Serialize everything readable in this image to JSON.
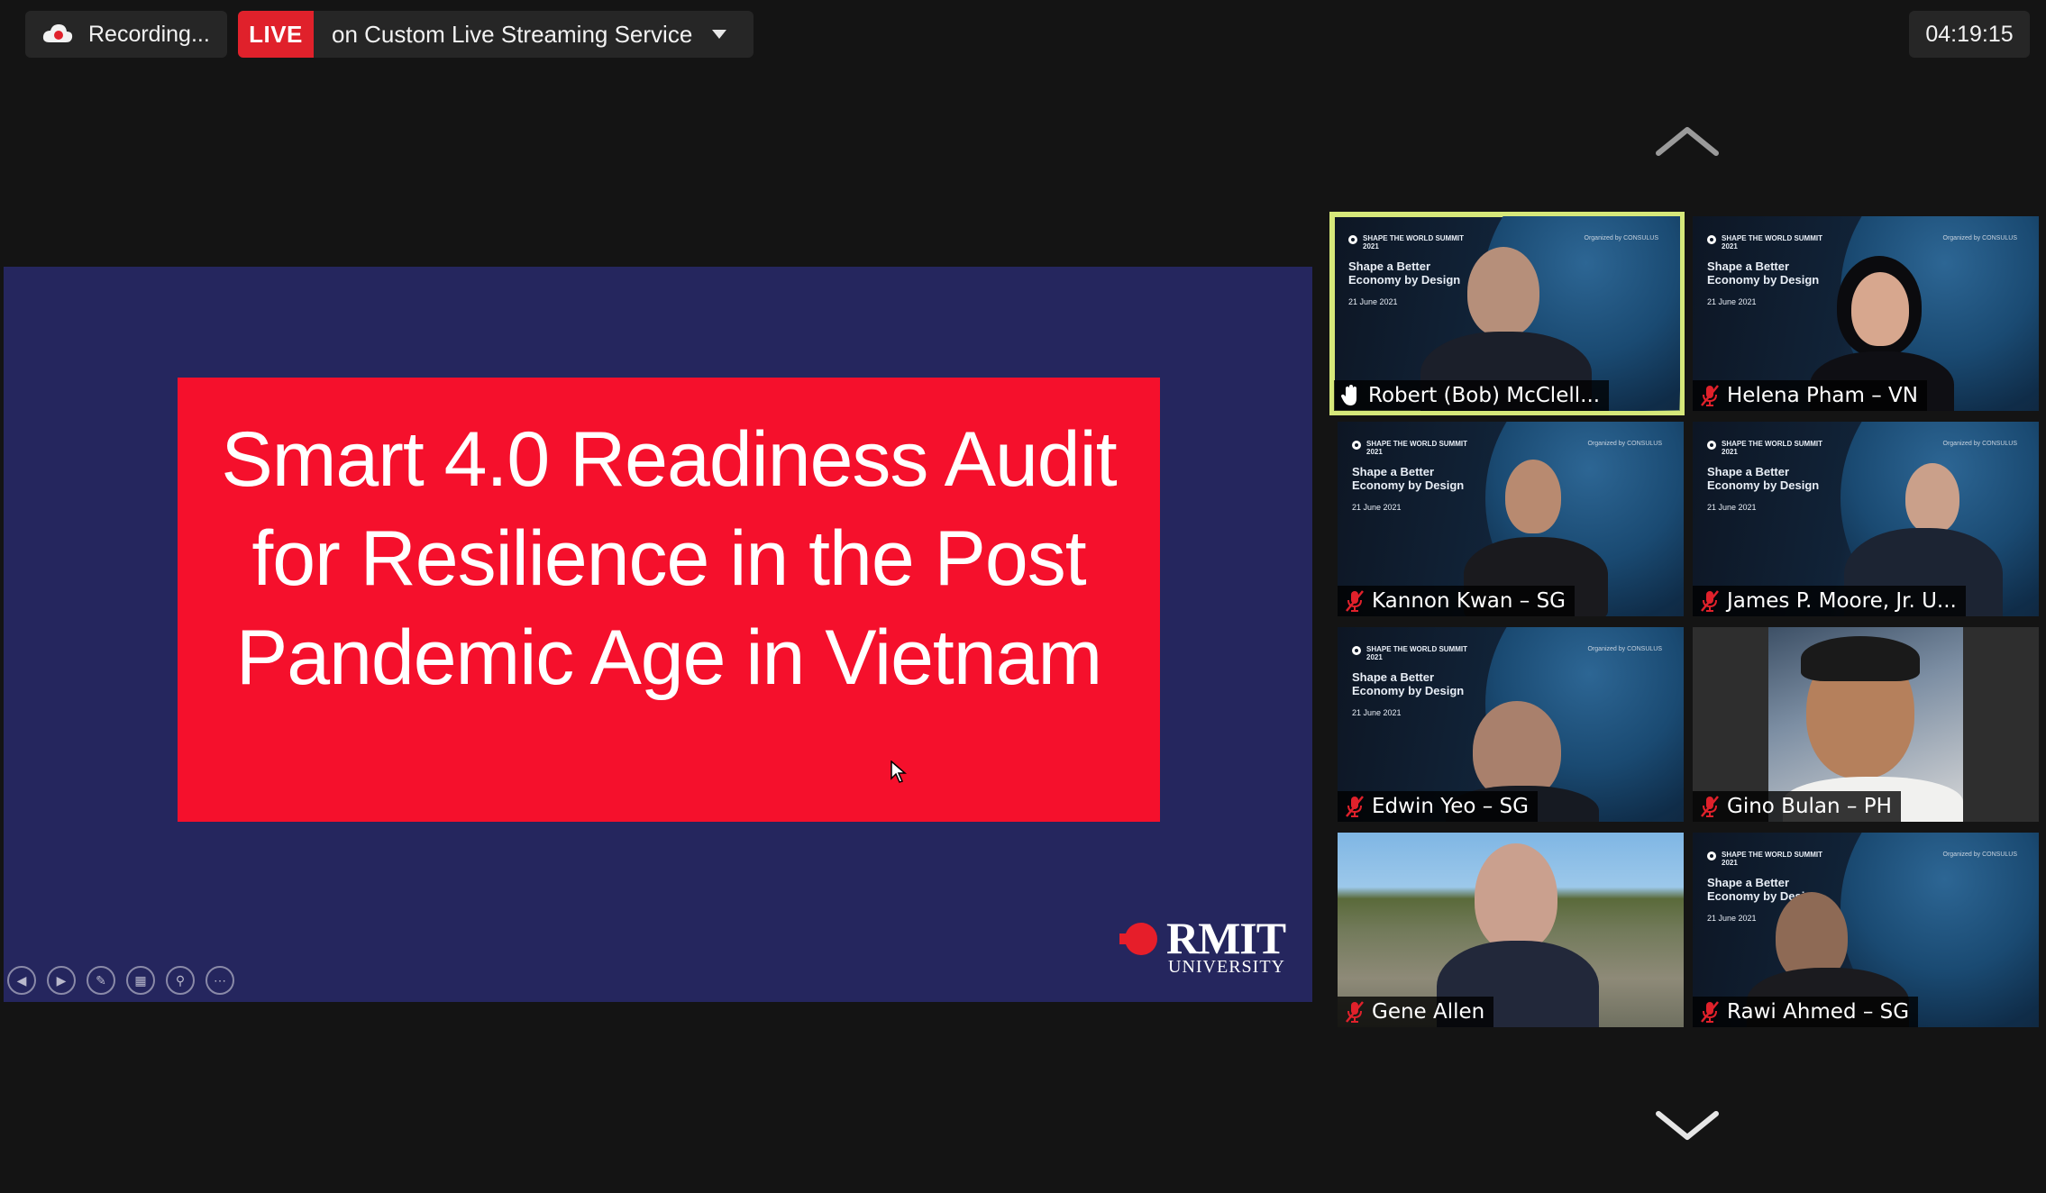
{
  "recording": {
    "label": "Recording..."
  },
  "live": {
    "badge": "LIVE",
    "text": "on Custom Live Streaming Service"
  },
  "timer": "04:19:15",
  "slide": {
    "title": "Smart 4.0 Readiness Audit for Resilience in the Post Pandemic Age in Vietnam",
    "logo_name": "RMIT",
    "logo_sub": "UNIVERSITY"
  },
  "background": {
    "summit": "SHAPE THE WORLD SUMMIT 2021",
    "headline": "Shape a Better Economy by Design",
    "date": "21 June 2021",
    "org": "Organized by CONSULUS"
  },
  "participants": [
    {
      "name": "Robert (Bob) McClell...",
      "status": "active-speaker",
      "icon": "raised-hand-icon"
    },
    {
      "name": "Helena Pham – VN",
      "status": "muted",
      "icon": "mic-muted-icon"
    },
    {
      "name": "Kannon Kwan – SG",
      "status": "muted",
      "icon": "mic-muted-icon"
    },
    {
      "name": "James P. Moore, Jr. U...",
      "status": "muted",
      "icon": "mic-muted-icon"
    },
    {
      "name": "Edwin Yeo – SG",
      "status": "muted",
      "icon": "mic-muted-icon"
    },
    {
      "name": "Gino Bulan – PH",
      "status": "muted",
      "icon": "mic-muted-icon"
    },
    {
      "name": "Gene Allen",
      "status": "muted",
      "icon": "mic-muted-icon"
    },
    {
      "name": "Rawi Ahmed – SG",
      "status": "muted",
      "icon": "mic-muted-icon"
    }
  ],
  "colors": {
    "live": "#e0212b",
    "slide_bg": "#25265e",
    "title_box": "#f5102c",
    "active_border": "#d6e87a"
  }
}
